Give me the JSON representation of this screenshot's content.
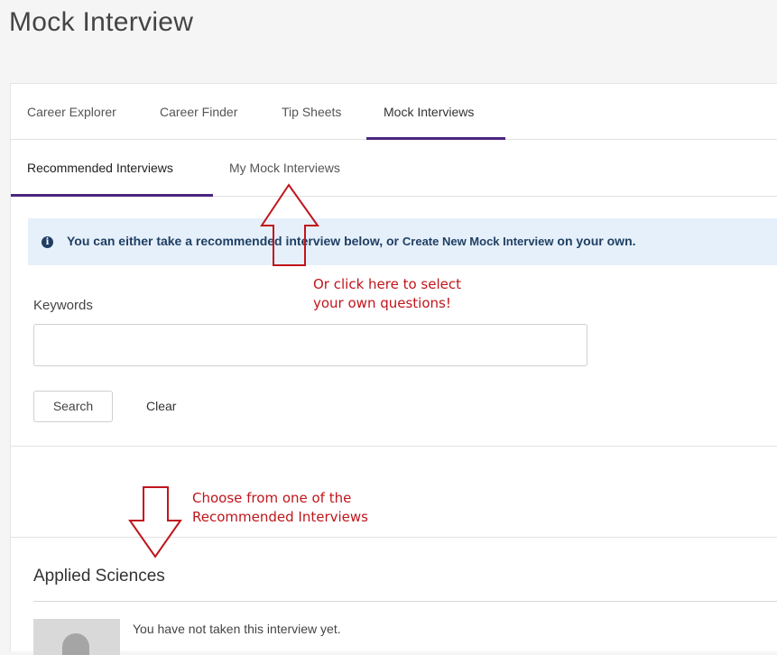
{
  "page": {
    "title": "Mock Interview"
  },
  "main_tabs": [
    {
      "label": "Career Explorer"
    },
    {
      "label": "Career Finder"
    },
    {
      "label": "Tip Sheets"
    },
    {
      "label": "Mock Interviews"
    }
  ],
  "sub_tabs": [
    {
      "label": "Recommended Interviews"
    },
    {
      "label": "My Mock Interviews"
    }
  ],
  "info": {
    "text_before": "You can either take a recommended interview below, or ",
    "link": "Create New Mock Interview",
    "text_after": " on your own."
  },
  "search": {
    "keywords_label": "Keywords",
    "keywords_value": "",
    "keywords_placeholder": "",
    "search_label": "Search",
    "clear_label": "Clear"
  },
  "section": {
    "title": "Applied Sciences",
    "status": "You have not taken this interview yet."
  },
  "annotations": {
    "top_line1": "Or click here to select",
    "top_line2": "your own questions!",
    "bottom_line1": "Choose from one of the",
    "bottom_line2": "Recommended Interviews"
  },
  "colors": {
    "accent": "#4b2580",
    "banner_bg": "#e6f0fb",
    "banner_text": "#1f3f63",
    "annotation": "#c0151b"
  }
}
